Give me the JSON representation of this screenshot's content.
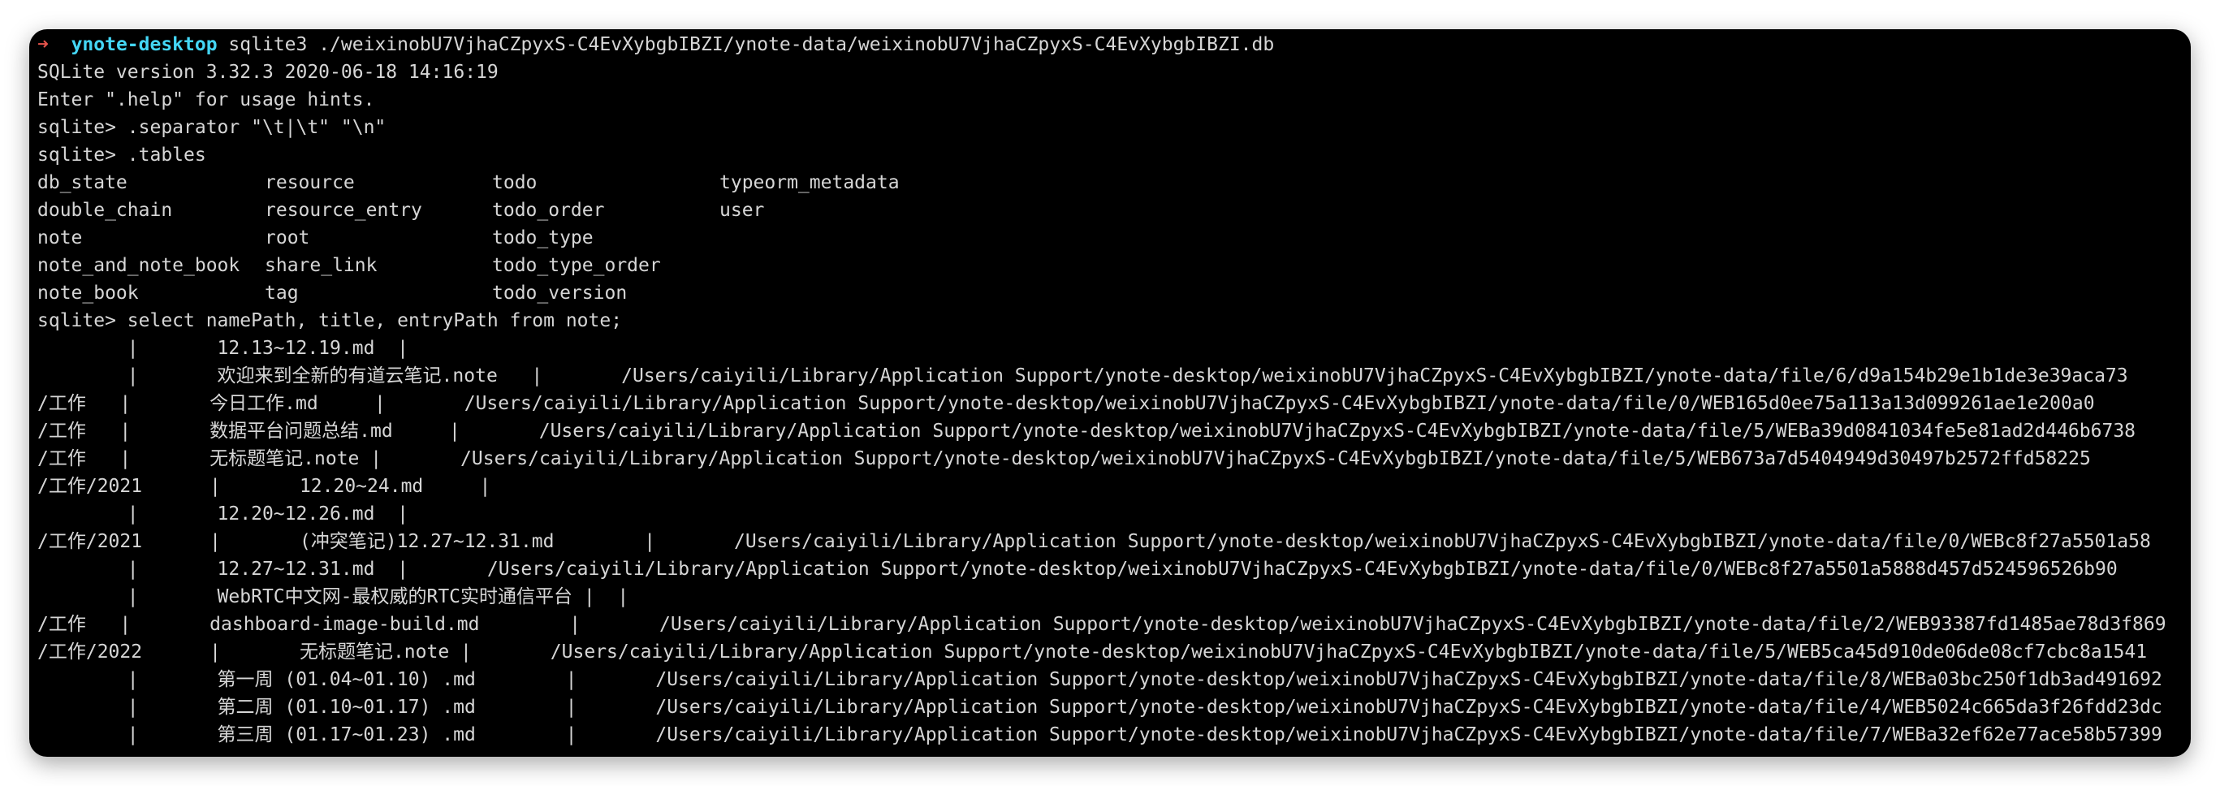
{
  "theme": {
    "background": "#000000",
    "text": "#d6d6d6",
    "prompt_arrow": "#e5534b",
    "prompt_host": "#44d6f5"
  },
  "prompt": {
    "arrow": "➜",
    "host": "ynote-desktop",
    "command": " sqlite3 ./weixinobU7VjhaCZpyxS-C4EvXybgbIBZI/ynote-data/weixinobU7VjhaCZpyxS-C4EvXybgbIBZI.db"
  },
  "banner": [
    "SQLite version 3.32.3 2020-06-18 14:16:19",
    "Enter \".help\" for usage hints."
  ],
  "commands": {
    "separator": "sqlite> .separator \"\\t|\\t\" \"\\n\"",
    "tables": "sqlite> .tables",
    "select": "sqlite> select namePath, title, entryPath from note;"
  },
  "tables_rows": [
    [
      "db_state",
      "resource",
      "todo",
      "typeorm_metadata"
    ],
    [
      "double_chain",
      "resource_entry",
      "todo_order",
      "user"
    ],
    [
      "note",
      "root",
      "todo_type",
      ""
    ],
    [
      "note_and_note_book",
      "share_link",
      "todo_type_order",
      ""
    ],
    [
      "note_book",
      "tag",
      "todo_version",
      ""
    ]
  ],
  "query_rows": [
    "        |       12.13~12.19.md  |",
    "        |       欢迎来到全新的有道云笔记.note   |       /Users/caiyili/Library/Application Support/ynote-desktop/weixinobU7VjhaCZpyxS-C4EvXybgbIBZI/ynote-data/file/6/d9a154b29e1b1de3e39aca73",
    "/工作   |       今日工作.md     |       /Users/caiyili/Library/Application Support/ynote-desktop/weixinobU7VjhaCZpyxS-C4EvXybgbIBZI/ynote-data/file/0/WEB165d0ee75a113a13d099261ae1e200a0",
    "/工作   |       数据平台问题总结.md     |       /Users/caiyili/Library/Application Support/ynote-desktop/weixinobU7VjhaCZpyxS-C4EvXybgbIBZI/ynote-data/file/5/WEBa39d0841034fe5e81ad2d446b6738",
    "/工作   |       无标题笔记.note |       /Users/caiyili/Library/Application Support/ynote-desktop/weixinobU7VjhaCZpyxS-C4EvXybgbIBZI/ynote-data/file/5/WEB673a7d5404949d30497b2572ffd58225",
    "/工作/2021      |       12.20~24.md     |",
    "        |       12.20~12.26.md  |",
    "/工作/2021      |       (冲突笔记)12.27~12.31.md        |       /Users/caiyili/Library/Application Support/ynote-desktop/weixinobU7VjhaCZpyxS-C4EvXybgbIBZI/ynote-data/file/0/WEBc8f27a5501a58",
    "        |       12.27~12.31.md  |       /Users/caiyili/Library/Application Support/ynote-desktop/weixinobU7VjhaCZpyxS-C4EvXybgbIBZI/ynote-data/file/0/WEBc8f27a5501a5888d457d524596526b90",
    "        |       WebRTC中文网-最权威的RTC实时通信平台 |  |",
    "/工作   |       dashboard-image-build.md        |       /Users/caiyili/Library/Application Support/ynote-desktop/weixinobU7VjhaCZpyxS-C4EvXybgbIBZI/ynote-data/file/2/WEB93387fd1485ae78d3f869",
    "/工作/2022      |       无标题笔记.note |       /Users/caiyili/Library/Application Support/ynote-desktop/weixinobU7VjhaCZpyxS-C4EvXybgbIBZI/ynote-data/file/5/WEB5ca45d910de06de08cf7cbc8a1541",
    "        |       第一周 (01.04~01.10) .md        |       /Users/caiyili/Library/Application Support/ynote-desktop/weixinobU7VjhaCZpyxS-C4EvXybgbIBZI/ynote-data/file/8/WEBa03bc250f1db3ad491692",
    "        |       第二周 (01.10~01.17) .md        |       /Users/caiyili/Library/Application Support/ynote-desktop/weixinobU7VjhaCZpyxS-C4EvXybgbIBZI/ynote-data/file/4/WEB5024c665da3f26fdd23dc",
    "        |       第三周 (01.17~01.23) .md        |       /Users/caiyili/Library/Application Support/ynote-desktop/weixinobU7VjhaCZpyxS-C4EvXybgbIBZI/ynote-data/file/7/WEBa32ef62e77ace58b57399"
  ]
}
